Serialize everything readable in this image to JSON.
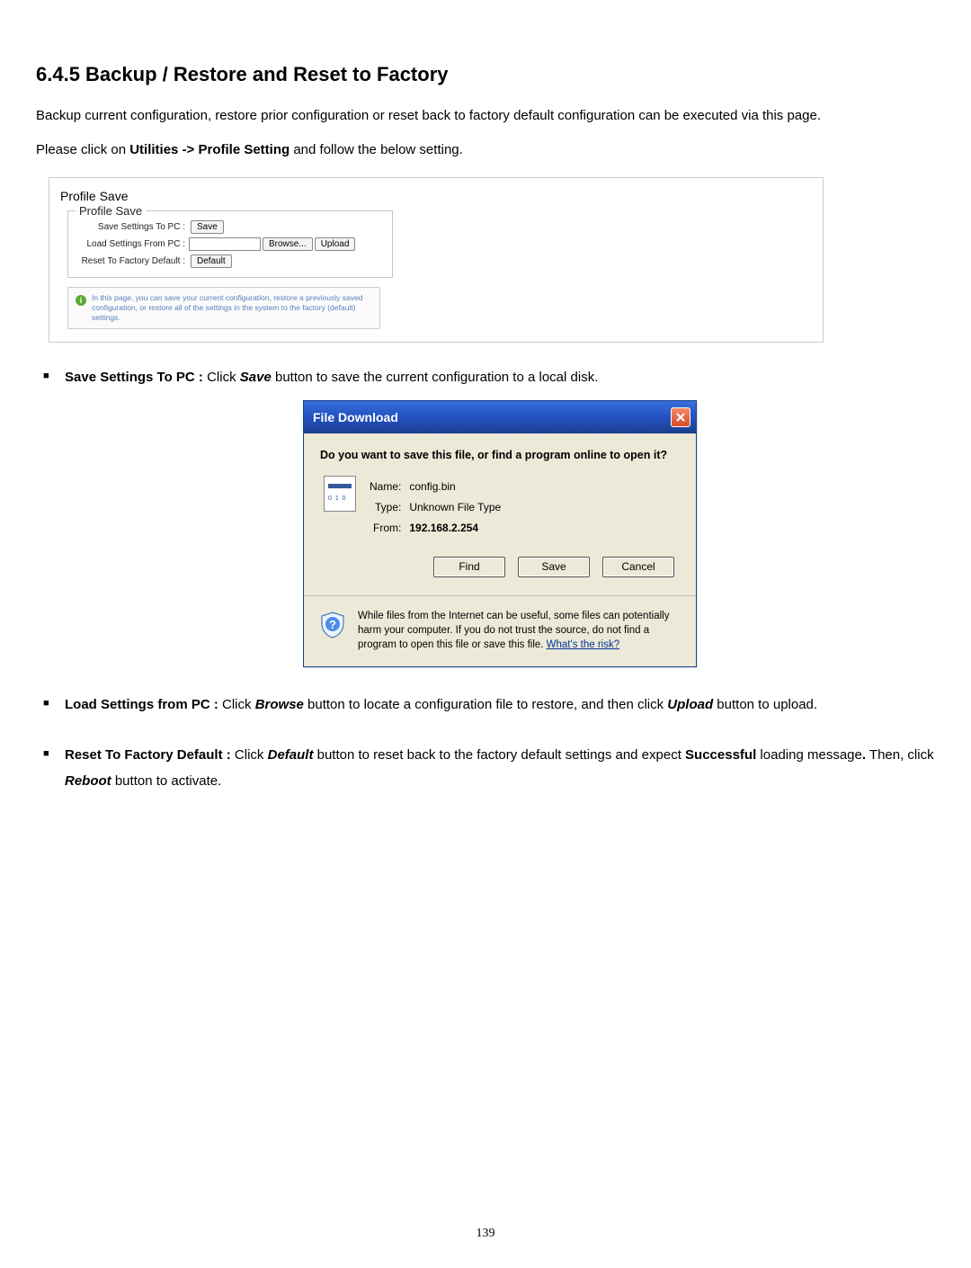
{
  "heading": "6.4.5 Backup / Restore and Reset to Factory",
  "intro_text": "Backup current configuration, restore prior configuration or reset back to factory default configuration can be executed via this page.",
  "nav_text_a": "Please click on ",
  "nav_text_b": "Utilities -> Profile Setting",
  "nav_text_c": " and follow the below setting.",
  "panel": {
    "title": "Profile Save",
    "legend": "Profile Save",
    "row1_label": "Save Settings To PC :",
    "row1_btn": "Save",
    "row2_label": "Load Settings From PC :",
    "row2_browse": "Browse...",
    "row2_upload": "Upload",
    "row3_label": "Reset To Factory Default :",
    "row3_btn": "Default",
    "info": "In this page, you can save your current configuration, restore a previously saved configuration, or restore all of the settings in the system to the factory (default) settings."
  },
  "bullet1_a": "Save Settings To PC :",
  "bullet1_b": " Click ",
  "bullet1_c": "Save",
  "bullet1_d": " button to save the current configuration to a local disk.",
  "dialog": {
    "title": "File Download",
    "prompt": "Do you want to save this file, or find a program online to open it?",
    "name_label": "Name:",
    "name_val": "config.bin",
    "type_label": "Type:",
    "type_val": "Unknown File Type",
    "from_label": "From:",
    "from_val": "192.168.2.254",
    "btn_find": "Find",
    "btn_save": "Save",
    "btn_cancel": "Cancel",
    "warning": "While files from the Internet can be useful, some files can potentially harm your computer. If you do not trust the source, do not find a program to open this file or save this file. ",
    "risk_link": "What's the risk?"
  },
  "bullet2_a": "Load Settings from PC :",
  "bullet2_b": " Click ",
  "bullet2_c": "Browse",
  "bullet2_d": " button to locate a configuration file to restore, and then click ",
  "bullet2_e": "Upload",
  "bullet2_f": " button to upload.",
  "bullet3_a": "Reset To Factory Default :",
  "bullet3_b": " Click ",
  "bullet3_c": "Default",
  "bullet3_d": " button to reset back to the factory default settings and expect ",
  "bullet3_e": "Successful",
  "bullet3_f": " loading message",
  "bullet3_g": ".",
  "bullet3_h": " Then, click ",
  "bullet3_i": "Reboot",
  "bullet3_j": " button to activate.",
  "page_number": "139"
}
